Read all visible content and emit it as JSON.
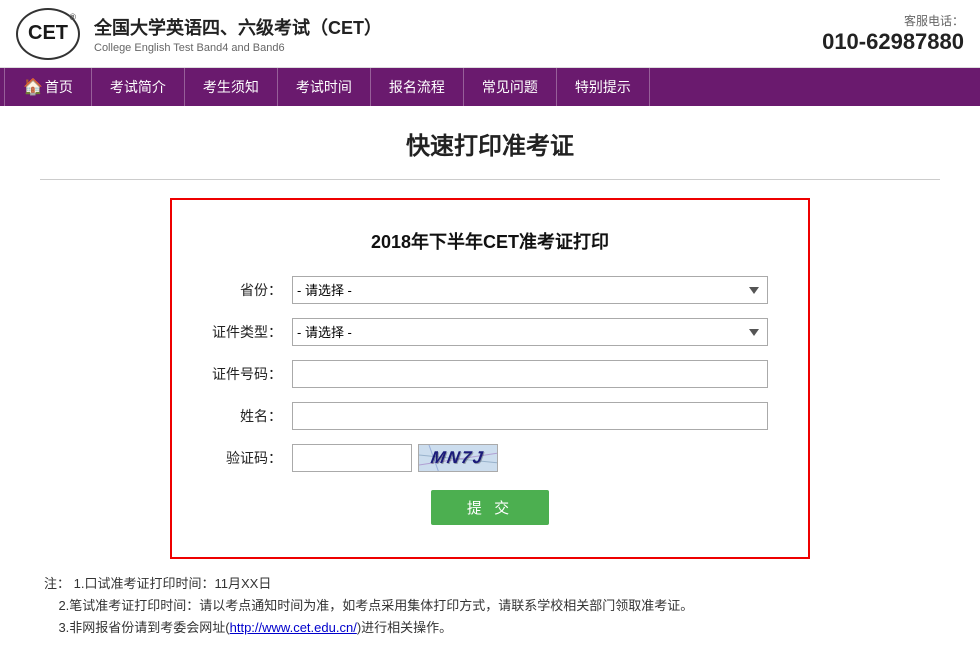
{
  "header": {
    "logo_text": "CET",
    "logo_reg": "®",
    "title_cn": "全国大学英语四、六级考试（CET）",
    "title_en": "College English Test Band4 and Band6",
    "service_label": "客服电话：",
    "service_phone": "010-62987880"
  },
  "nav": {
    "items": [
      {
        "id": "home",
        "label": "首页",
        "icon": "🏠"
      },
      {
        "id": "intro",
        "label": "考试简介"
      },
      {
        "id": "notice",
        "label": "考生须知"
      },
      {
        "id": "time",
        "label": "考试时间"
      },
      {
        "id": "register",
        "label": "报名流程"
      },
      {
        "id": "faq",
        "label": "常见问题"
      },
      {
        "id": "tips",
        "label": "特别提示"
      }
    ]
  },
  "main": {
    "page_title": "快速打印准考证",
    "form": {
      "title": "2018年下半年CET准考证打印",
      "province_label": "省份：",
      "province_placeholder": "- 请选择 -",
      "id_type_label": "证件类型：",
      "id_type_placeholder": "- 请选择 -",
      "id_number_label": "证件号码：",
      "id_number_placeholder": "",
      "name_label": "姓名：",
      "name_placeholder": "",
      "captcha_label": "验证码：",
      "captcha_text": "MN7J",
      "submit_label": "提  交"
    },
    "notes": {
      "intro": "注：",
      "items": [
        "1.口试准考证打印时间：11月XX日",
        "2.笔试准考证打印时间：请以考点通知时间为准，如考点采用集体打印方式，请联系学校相关部门领取准考证。",
        "3.非网报省份请到考委会网址(http://www.cet.edu.cn/)进行相关操作。"
      ],
      "link_text": "http://www.cet.edu.cn/",
      "link_url": "http://www.cet.edu.cn/"
    }
  }
}
